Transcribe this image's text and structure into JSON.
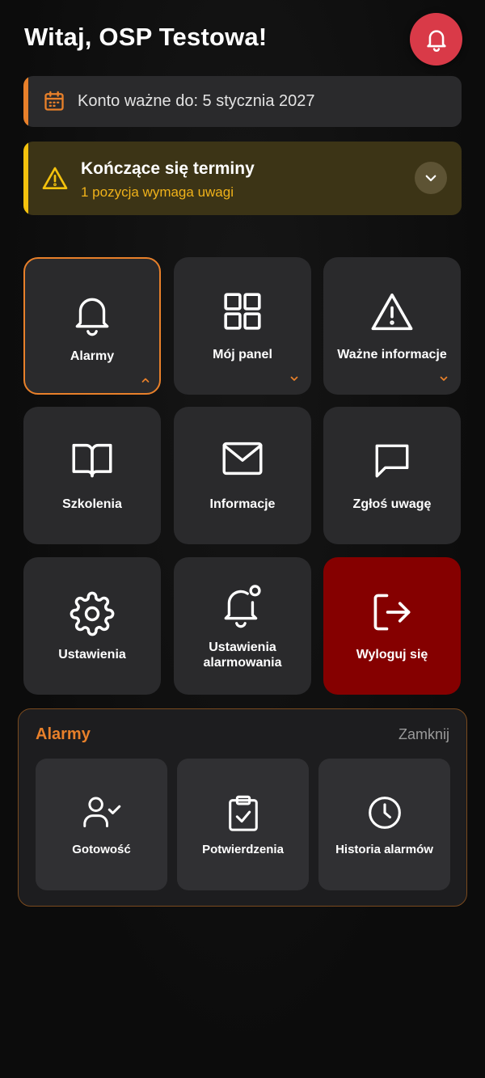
{
  "header": {
    "greeting": "Witaj, OSP Testowa!",
    "alarm_icon": "bell-icon",
    "alarm_button_color": "#d93a48"
  },
  "account_card": {
    "icon": "calendar-icon",
    "text": "Konto ważne do: 5 stycznia 2027",
    "accent_color": "#e8802a"
  },
  "deadlines_card": {
    "icon": "warning-icon",
    "title": "Kończące się terminy",
    "subtitle": "1 pozycja wymaga uwagi",
    "accent_color": "#f4c20d",
    "toggle_icon": "chevron-down-icon"
  },
  "tiles": [
    {
      "id": "alarmy",
      "label": "Alarmy",
      "icon": "bell-icon",
      "state": "expanded"
    },
    {
      "id": "moj-panel",
      "label": "Mój panel",
      "icon": "grid-icon",
      "state": "collapsed"
    },
    {
      "id": "wazne-informacje",
      "label": "Ważne informacje",
      "icon": "warning-icon",
      "state": "collapsed"
    },
    {
      "id": "szkolenia",
      "label": "Szkolenia",
      "icon": "book-icon"
    },
    {
      "id": "informacje",
      "label": "Informacje",
      "icon": "mail-icon"
    },
    {
      "id": "zglos-uwage",
      "label": "Zgłoś uwagę",
      "icon": "chat-icon"
    },
    {
      "id": "ustawienia",
      "label": "Ustawienia",
      "icon": "gear-icon"
    },
    {
      "id": "ustawienia-alarmowania",
      "label_line1": "Ustawienia",
      "label_line2": "alarmowania",
      "icon": "bell-dot-icon"
    },
    {
      "id": "wyloguj",
      "label": "Wyloguj się",
      "icon": "logout-icon",
      "color": "#850000"
    }
  ],
  "alarm_panel": {
    "title": "Alarmy",
    "close_label": "Zamknij",
    "accent_color": "#e8802a",
    "items": [
      {
        "label": "Gotowość",
        "icon": "user-check-icon"
      },
      {
        "label": "Potwierdzenia",
        "icon": "clipboard-check-icon"
      },
      {
        "label": "Historia alarmów",
        "icon": "clock-icon"
      }
    ]
  }
}
